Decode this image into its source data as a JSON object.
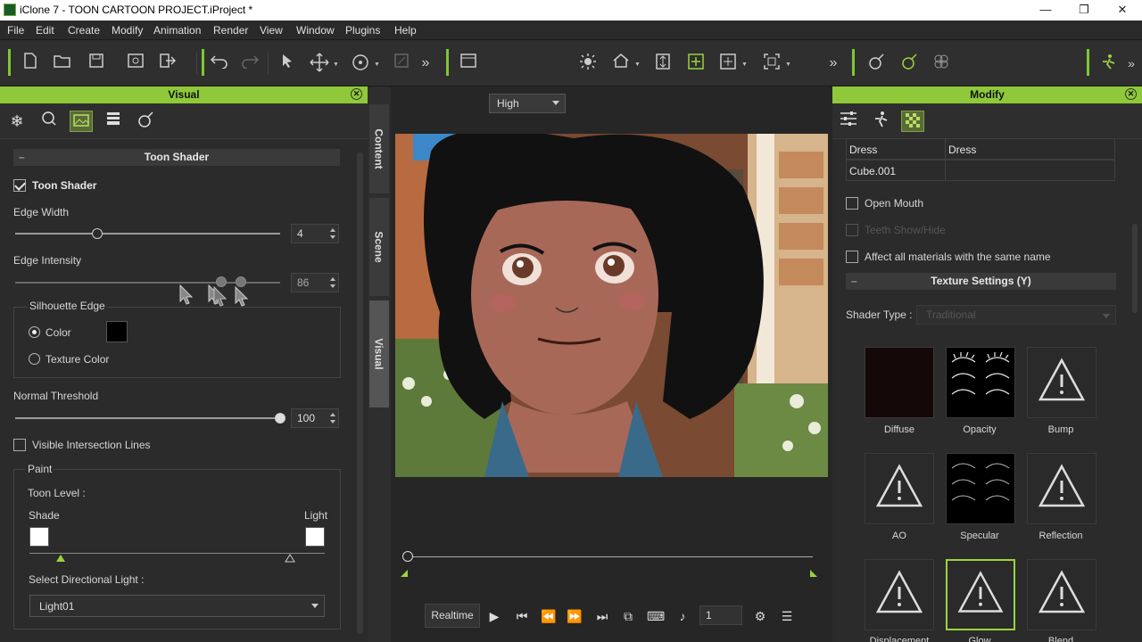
{
  "window": {
    "title": "iClone 7 - TOON CARTOON PROJECT.iProject *",
    "minimize": "—",
    "maximize": "❐",
    "close": "✕"
  },
  "menu": [
    "File",
    "Edit",
    "Create",
    "Modify",
    "Animation",
    "Render",
    "View",
    "Window",
    "Plugins",
    "Help"
  ],
  "toolbar": {
    "quality": "High"
  },
  "visual_panel": {
    "title": "Visual",
    "section_title": "Toon Shader",
    "toon_shader_label": "Toon Shader",
    "toon_shader_checked": true,
    "edge_width_label": "Edge Width",
    "edge_width_value": "4",
    "edge_width_fraction": 0.31,
    "edge_intensity_label": "Edge Intensity",
    "edge_intensity_value": "86",
    "silhouette_label": "Silhouette Edge",
    "color_option": "Color",
    "texture_color_option": "Texture Color",
    "silhouette_color": "#000000",
    "normal_threshold_label": "Normal Threshold",
    "normal_threshold_value": "100",
    "normal_threshold_fraction": 1.0,
    "intersection_label": "Visible Intersection Lines",
    "paint_label": "Paint",
    "toon_level_label": "Toon Level :",
    "shade_label": "Shade",
    "light_label": "Light",
    "select_light_label": "Select Directional Light :",
    "light_value": "Light01"
  },
  "side_tabs": [
    "Content",
    "Scene",
    "Visual"
  ],
  "viewport_footer": {
    "mode": "Realtime",
    "frame": "1"
  },
  "modify_panel": {
    "title": "Modify",
    "table": [
      [
        "Dress",
        "Dress"
      ],
      [
        "Cube.001",
        ""
      ]
    ],
    "open_mouth_label": "Open Mouth",
    "teeth_label": "Teeth Show/Hide",
    "affect_label": "Affect all materials with the same name",
    "texture_settings": "Texture Settings  (Y)",
    "shader_type_label": "Shader Type :",
    "shader_type_value": "Traditional",
    "textures": [
      "Diffuse",
      "Opacity",
      "Bump",
      "AO",
      "Specular",
      "Reflection",
      "Displacement",
      "Glow",
      "Blend"
    ]
  },
  "colors": {
    "accent": "#8fc939",
    "panel": "#2b2b2b"
  }
}
